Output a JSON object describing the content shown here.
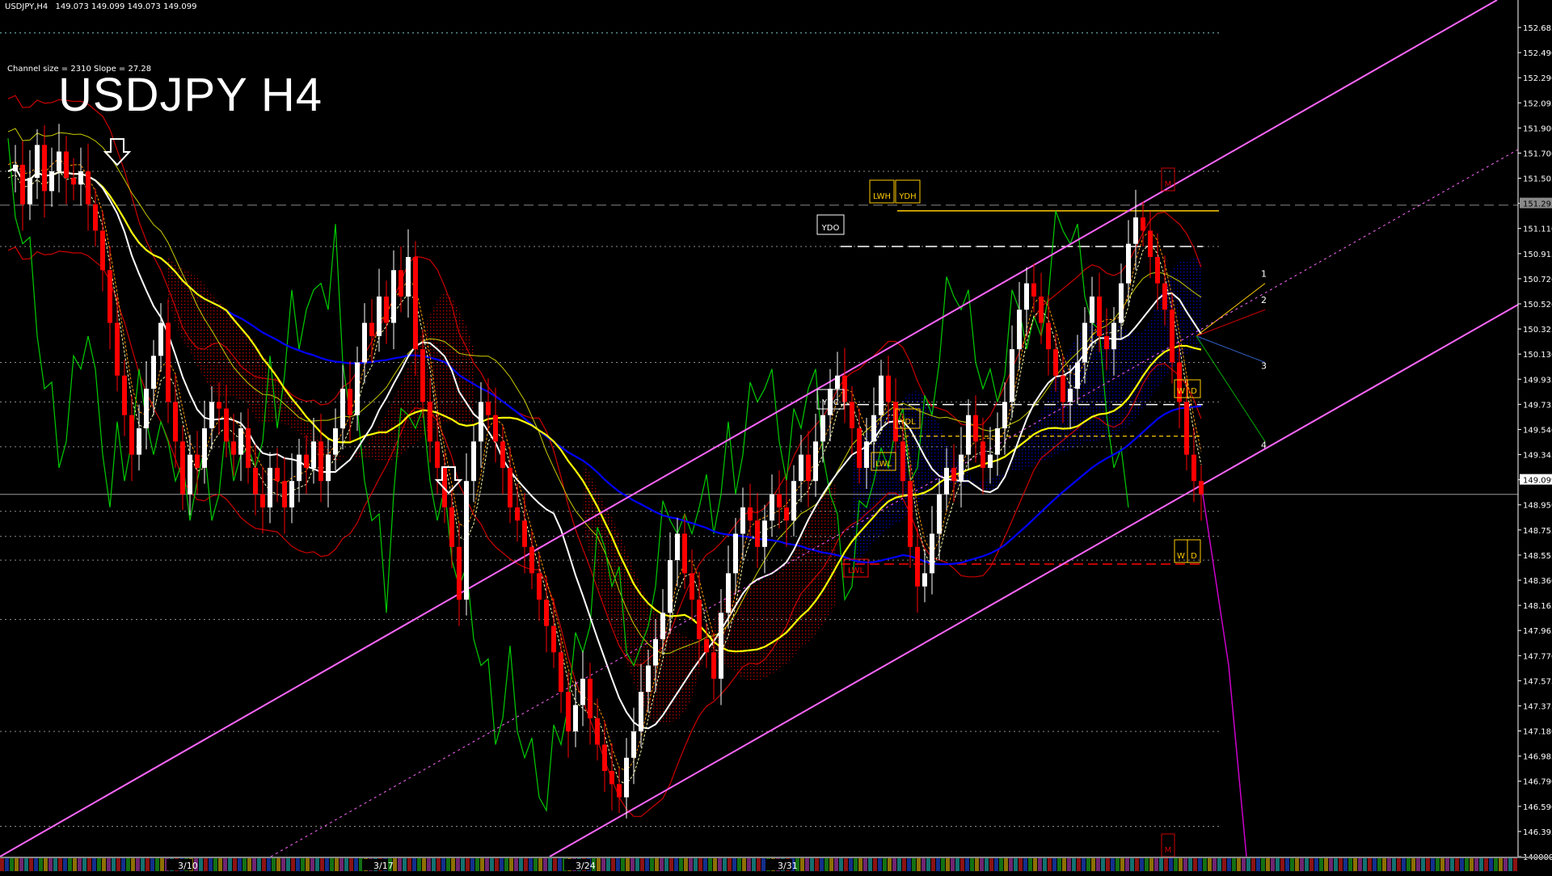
{
  "header": {
    "symbol_timeframe": "USDJPY,H4",
    "ohlc": "149.073 149.099 149.073 149.099"
  },
  "channel_info": "Channel size = 2310 Slope = 27.28",
  "title": "USDJPY H4",
  "colors": {
    "background": "#000000",
    "bull_candle": "#ffffff",
    "bear_candle": "#ff0000",
    "channel": "#ff66ff",
    "ma_white": "#ffffff",
    "ma_yellow": "#ffff00",
    "ma_blue": "#0000ff",
    "chikou_green": "#00cc00",
    "bollinger_red": "#cc0000",
    "cloud_bear": "#cc0000",
    "cloud_bull": "#0000cc",
    "kijun_yellow": "#cccc00",
    "level_orange": "#ffcc00",
    "projection_magenta": "#cc00cc"
  },
  "price_axis": {
    "labels": [
      "152.685",
      "152.490",
      "152.290",
      "152.095",
      "151.900",
      "151.700",
      "151.505",
      "151.293",
      "151.110",
      "150.915",
      "150.720",
      "150.520",
      "150.325",
      "150.130",
      "149.935",
      "149.735",
      "149.540",
      "149.345",
      "149.099",
      "148.950",
      "148.755",
      "148.555",
      "148.360",
      "148.165",
      "147.965",
      "147.770",
      "147.575",
      "147.375",
      "147.180",
      "146.985",
      "146.790",
      "146.590",
      "146.395",
      "140000"
    ],
    "current_price": "149.099",
    "marked_level": "151.293"
  },
  "date_labels": [
    "3/10",
    "3/17",
    "3/24",
    "3/31"
  ],
  "level_labels": [
    "LWH",
    "YDH",
    "YDO",
    "YDC",
    "YDL",
    "LWL",
    "LWL",
    "W",
    "D",
    "W",
    "D",
    "M",
    "M"
  ],
  "projection_labels": [
    "1",
    "2",
    "3",
    "4"
  ],
  "chart_data": {
    "type": "candlestick",
    "title": "USDJPY H4",
    "symbol": "USDJPY",
    "timeframe": "H4",
    "x_ticks": [
      "3/10",
      "3/17",
      "3/24",
      "3/31"
    ],
    "ylim": [
      146.35,
      152.85
    ],
    "last_price": 149.099,
    "close_path": [
      151.55,
      151.6,
      151.3,
      151.5,
      151.75,
      151.4,
      151.55,
      151.7,
      151.5,
      151.45,
      151.55,
      151.3,
      151.1,
      150.8,
      150.4,
      150.0,
      149.7,
      149.4,
      149.6,
      149.9,
      150.15,
      150.4,
      149.8,
      149.5,
      149.1,
      149.4,
      149.3,
      149.6,
      149.8,
      149.75,
      149.5,
      149.4,
      149.6,
      149.3,
      149.1,
      149.0,
      149.3,
      149.2,
      149.0,
      149.2,
      149.4,
      149.3,
      149.5,
      149.2,
      149.4,
      149.6,
      149.9,
      149.7,
      150.1,
      150.4,
      150.3,
      150.6,
      150.4,
      150.8,
      150.6,
      150.9,
      150.2,
      149.8,
      149.5,
      149.3,
      149.0,
      148.7,
      148.3,
      149.2,
      149.5,
      149.8,
      149.7,
      149.5,
      149.3,
      149.0,
      148.9,
      148.7,
      148.5,
      148.3,
      148.1,
      147.9,
      147.6,
      147.3,
      147.5,
      147.7,
      147.4,
      147.2,
      147.0,
      146.9,
      146.8,
      147.1,
      147.3,
      147.6,
      147.8,
      148.0,
      148.2,
      148.6,
      148.8,
      148.5,
      148.3,
      148.0,
      147.9,
      147.7,
      148.2,
      148.5,
      148.8,
      149.0,
      148.9,
      148.7,
      148.9,
      149.1,
      149.0,
      148.9,
      149.2,
      149.4,
      149.2,
      149.5,
      149.7,
      149.9,
      150.0,
      149.8,
      149.6,
      149.3,
      149.5,
      149.7,
      150.0,
      149.8,
      149.5,
      149.2,
      148.7,
      148.4,
      148.5,
      148.8,
      149.1,
      149.3,
      149.2,
      149.4,
      149.7,
      149.5,
      149.3,
      149.4,
      149.6,
      149.8,
      150.2,
      150.5,
      150.7,
      150.6,
      150.4,
      150.2,
      150.0,
      149.8,
      149.9,
      150.1,
      150.4,
      150.6,
      150.3,
      150.2,
      150.4,
      150.7,
      151.0,
      151.2,
      151.1,
      150.9,
      150.7,
      150.5,
      150.1,
      149.8,
      149.4,
      149.2,
      149.099
    ],
    "channel": {
      "upper": [
        {
          "x": "3/5",
          "y": 146.4
        },
        {
          "x": "4/9",
          "y": 152.85
        }
      ],
      "middle": [
        {
          "x": "3/20",
          "y": 146.4
        },
        {
          "x": "4/9",
          "y": 151.4
        }
      ],
      "lower": [
        {
          "x": "3/23",
          "y": 146.4
        },
        {
          "x": "4/9",
          "y": 150.5
        }
      ]
    },
    "levels": [
      {
        "label": "LWH / YDH",
        "price": 151.25
      },
      {
        "label": "YDO",
        "price": 150.98
      },
      {
        "label": "YDC",
        "price": 149.78
      },
      {
        "label": "YDL",
        "price": 149.54
      },
      {
        "label": "LWL",
        "price": 148.57
      }
    ]
  }
}
